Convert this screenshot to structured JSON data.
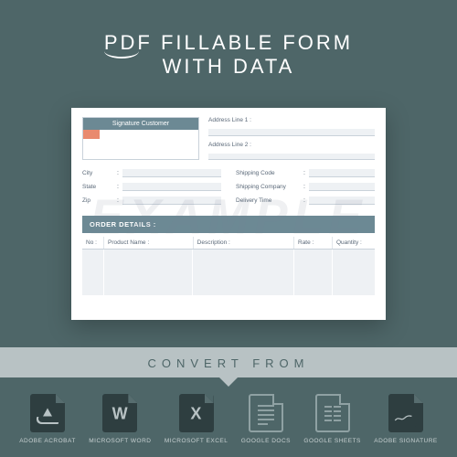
{
  "title": {
    "line1": "PDF FILLABLE FORM",
    "line2": "WITH DATA"
  },
  "watermark": "EXAMPLE",
  "form": {
    "signature_label": "Signature Customer",
    "address1_label": "Address Line 1 :",
    "address2_label": "Address Line 2 :",
    "left_fields": [
      {
        "label": "City"
      },
      {
        "label": "State"
      },
      {
        "label": "Zip"
      }
    ],
    "right_fields": [
      {
        "label": "Shipping Code"
      },
      {
        "label": "Shipping Company"
      },
      {
        "label": "Delivery Time"
      }
    ],
    "order_header": "ORDER DETAILS :",
    "columns": {
      "no": "No :",
      "product": "Product Name :",
      "description": "Description :",
      "rate": "Rate :",
      "quantity": "Quantity :"
    }
  },
  "convert_label": "CONVERT FROM",
  "apps": [
    {
      "name": "ADOBE ACROBAT"
    },
    {
      "name": "MICROSOFT WORD"
    },
    {
      "name": "MICROSOFT EXCEL"
    },
    {
      "name": "GOOGLE DOCS"
    },
    {
      "name": "GOOGLE SHEETS"
    },
    {
      "name": "ADOBE SIGNATURE"
    }
  ]
}
